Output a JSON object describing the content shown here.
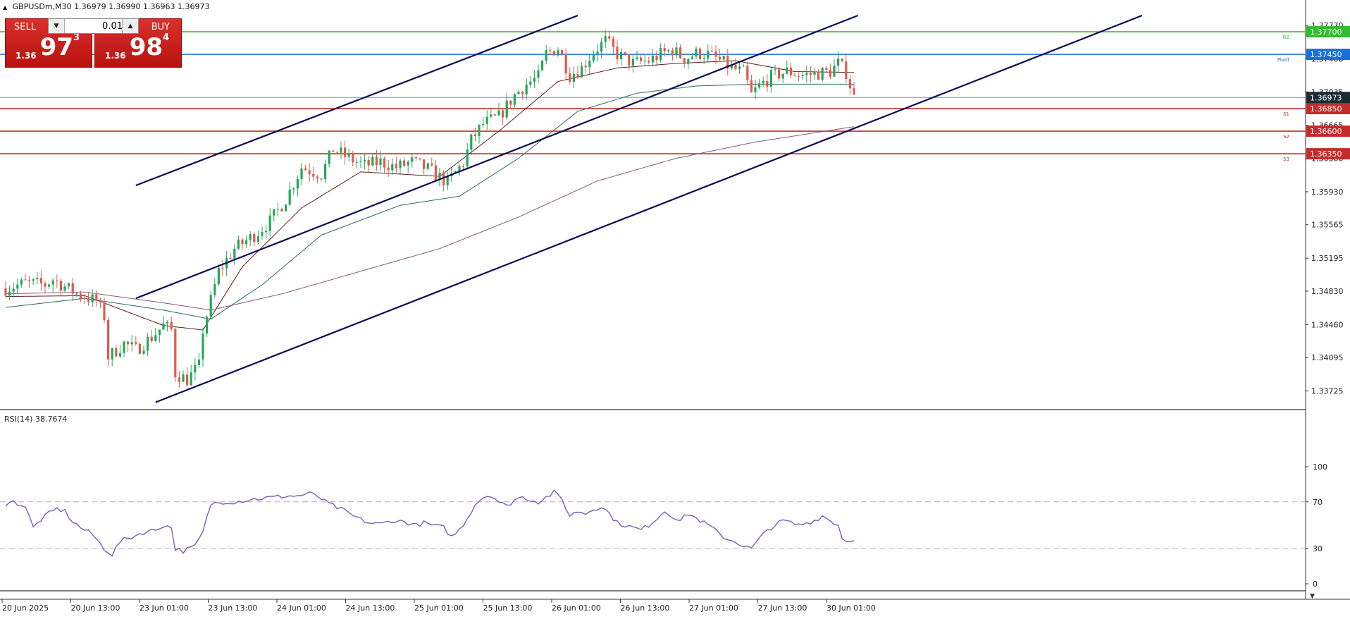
{
  "header": {
    "symbol": "GBPUSDm,M30",
    "ohlc": "1.36979 1.36990 1.36963 1.36973"
  },
  "trade_panel": {
    "sell_label": "SELL",
    "buy_label": "BUY",
    "lot_value": "0.01",
    "sell_price_main": "1.36",
    "sell_price_big": "97",
    "sell_price_sup": "3",
    "buy_price_main": "1.36",
    "buy_price_big": "98",
    "buy_price_sup": "4"
  },
  "colors": {
    "candle_up": "#26a65b",
    "candle_down": "#e05a4e",
    "channel": "#0b0b55",
    "level_r2": "#33bb33",
    "level_pivot": "#1a6fd6",
    "level_support": "#c62b2b",
    "current_price": "#1e2a33",
    "ma_fast": "#5a2020",
    "ma_mid": "#2f6a62",
    "ma_slow": "#8a5580",
    "rsi_line": "#7b5fb8"
  },
  "chart_data": {
    "type": "candlestick",
    "instrument": "GBPUSDm",
    "timeframe": "M30",
    "y_range": [
      1.3355,
      1.3788
    ],
    "price_ticks": [
      "1.37770",
      "1.37400",
      "1.37035",
      "1.36665",
      "1.36300",
      "1.35930",
      "1.35565",
      "1.35195",
      "1.34830",
      "1.34460",
      "1.34095",
      "1.33725"
    ],
    "x_ticks": [
      "20 Jun 2025",
      "20 Jun 13:00",
      "23 Jun 01:00",
      "23 Jun 13:00",
      "24 Jun 01:00",
      "24 Jun 13:00",
      "25 Jun 01:00",
      "25 Jun 13:00",
      "26 Jun 01:00",
      "26 Jun 13:00",
      "27 Jun 01:00",
      "27 Jun 13:00",
      "30 Jun 01:00"
    ],
    "current_price": "1.36973",
    "levels": [
      {
        "tag": "R2",
        "price": 1.377,
        "label": "1.37700",
        "kind": "r2"
      },
      {
        "tag": "Pivot",
        "price": 1.3745,
        "label": "1.37450",
        "kind": "pivot"
      },
      {
        "tag": "S1",
        "price": 1.3685,
        "label": "1.36850",
        "kind": "support"
      },
      {
        "tag": "S2",
        "price": 1.366,
        "label": "1.36600",
        "kind": "support"
      },
      {
        "tag": "S3",
        "price": 1.3635,
        "label": "1.36350",
        "kind": "support"
      }
    ],
    "price_anchors": [
      [
        0,
        1.3486
      ],
      [
        5,
        1.3492
      ],
      [
        10,
        1.349
      ],
      [
        12,
        1.3496
      ],
      [
        15,
        1.3488
      ],
      [
        18,
        1.348
      ],
      [
        23,
        1.3472
      ],
      [
        25,
        1.3455
      ],
      [
        26,
        1.341
      ],
      [
        30,
        1.3425
      ],
      [
        33,
        1.3418
      ],
      [
        37,
        1.3432
      ],
      [
        40,
        1.3445
      ],
      [
        42,
        1.344
      ],
      [
        43,
        1.3392
      ],
      [
        46,
        1.3385
      ],
      [
        49,
        1.34
      ],
      [
        50,
        1.344
      ],
      [
        54,
        1.3505
      ],
      [
        58,
        1.353
      ],
      [
        63,
        1.3545
      ],
      [
        67,
        1.356
      ],
      [
        71,
        1.3585
      ],
      [
        75,
        1.362
      ],
      [
        80,
        1.3612
      ],
      [
        83,
        1.364
      ],
      [
        87,
        1.363
      ],
      [
        91,
        1.3622
      ],
      [
        95,
        1.3626
      ],
      [
        99,
        1.362
      ],
      [
        103,
        1.3626
      ],
      [
        107,
        1.3618
      ],
      [
        112,
        1.3603
      ],
      [
        116,
        1.3625
      ],
      [
        118,
        1.365
      ],
      [
        121,
        1.3668
      ],
      [
        125,
        1.3676
      ],
      [
        129,
        1.37
      ],
      [
        132,
        1.3712
      ],
      [
        135,
        1.372
      ],
      [
        137,
        1.3746
      ],
      [
        140,
        1.3752
      ],
      [
        143,
        1.3722
      ],
      [
        146,
        1.373
      ],
      [
        149,
        1.3748
      ],
      [
        152,
        1.376
      ],
      [
        155,
        1.3745
      ],
      [
        159,
        1.3735
      ],
      [
        163,
        1.3738
      ],
      [
        166,
        1.3745
      ],
      [
        169,
        1.375
      ],
      [
        172,
        1.374
      ],
      [
        175,
        1.3746
      ],
      [
        178,
        1.3745
      ],
      [
        181,
        1.3738
      ],
      [
        184,
        1.373
      ],
      [
        187,
        1.3725
      ],
      [
        189,
        1.37
      ],
      [
        191,
        1.371
      ],
      [
        194,
        1.372
      ],
      [
        198,
        1.3726
      ],
      [
        202,
        1.3722
      ],
      [
        206,
        1.3724
      ],
      [
        209,
        1.3726
      ],
      [
        211,
        1.3735
      ],
      [
        213,
        1.3725
      ],
      [
        215,
        1.3697
      ]
    ],
    "moving_averages": [
      {
        "id": "ma-fast",
        "color_key": "ma_fast",
        "points": [
          [
            0,
            1.3477
          ],
          [
            20,
            1.3478
          ],
          [
            40,
            1.3445
          ],
          [
            50,
            1.344
          ],
          [
            60,
            1.351
          ],
          [
            75,
            1.3575
          ],
          [
            90,
            1.3615
          ],
          [
            110,
            1.361
          ],
          [
            125,
            1.366
          ],
          [
            140,
            1.3715
          ],
          [
            155,
            1.373
          ],
          [
            170,
            1.3735
          ],
          [
            185,
            1.3738
          ],
          [
            200,
            1.3726
          ],
          [
            215,
            1.3725
          ]
        ]
      },
      {
        "id": "ma-mid",
        "color_key": "ma_mid",
        "points": [
          [
            0,
            1.3465
          ],
          [
            20,
            1.3475
          ],
          [
            40,
            1.3462
          ],
          [
            52,
            1.3452
          ],
          [
            65,
            1.349
          ],
          [
            80,
            1.3545
          ],
          [
            100,
            1.3578
          ],
          [
            115,
            1.3588
          ],
          [
            130,
            1.363
          ],
          [
            145,
            1.3682
          ],
          [
            160,
            1.3702
          ],
          [
            175,
            1.371
          ],
          [
            190,
            1.3712
          ],
          [
            215,
            1.3712
          ]
        ]
      },
      {
        "id": "ma-slow",
        "color_key": "ma_slow",
        "points": [
          [
            0,
            1.348
          ],
          [
            20,
            1.3482
          ],
          [
            40,
            1.347
          ],
          [
            52,
            1.3462
          ],
          [
            70,
            1.348
          ],
          [
            90,
            1.3505
          ],
          [
            110,
            1.353
          ],
          [
            130,
            1.3565
          ],
          [
            150,
            1.3605
          ],
          [
            170,
            1.363
          ],
          [
            190,
            1.3648
          ],
          [
            215,
            1.3665
          ]
        ]
      }
    ],
    "channels": [
      {
        "id": "channel-upper-line",
        "from": [
          33,
          1.36
        ],
        "to": [
          145,
          1.3788
        ]
      },
      {
        "id": "channel-middle-line",
        "from": [
          33,
          1.3475
        ],
        "to": [
          216,
          1.3788
        ]
      },
      {
        "id": "channel-lower-line",
        "from": [
          38,
          1.336
        ],
        "to": [
          288,
          1.3788
        ]
      }
    ],
    "rsi": {
      "label": "RSI(14) 38.7674",
      "levels": [
        70,
        30
      ],
      "y_ticks": [
        "100",
        "70",
        "30",
        "0"
      ],
      "anchors": [
        [
          0,
          68
        ],
        [
          2,
          70
        ],
        [
          5,
          66
        ],
        [
          7,
          48
        ],
        [
          9,
          55
        ],
        [
          11,
          60
        ],
        [
          13,
          64
        ],
        [
          15,
          62
        ],
        [
          17,
          53
        ],
        [
          19,
          48
        ],
        [
          22,
          42
        ],
        [
          25,
          30
        ],
        [
          27,
          25
        ],
        [
          29,
          36
        ],
        [
          32,
          40
        ],
        [
          35,
          44
        ],
        [
          38,
          46
        ],
        [
          40,
          50
        ],
        [
          42,
          48
        ],
        [
          43,
          30
        ],
        [
          45,
          28
        ],
        [
          48,
          32
        ],
        [
          50,
          44
        ],
        [
          52,
          68
        ],
        [
          55,
          70
        ],
        [
          58,
          70
        ],
        [
          62,
          72
        ],
        [
          65,
          73
        ],
        [
          68,
          74
        ],
        [
          71,
          75
        ],
        [
          74,
          75
        ],
        [
          77,
          77
        ],
        [
          79,
          75
        ],
        [
          81,
          70
        ],
        [
          84,
          65
        ],
        [
          86,
          62
        ],
        [
          88,
          58
        ],
        [
          90,
          55
        ],
        [
          92,
          52
        ],
        [
          95,
          51
        ],
        [
          98,
          54
        ],
        [
          101,
          53
        ],
        [
          104,
          50
        ],
        [
          106,
          52
        ],
        [
          108,
          50
        ],
        [
          111,
          48
        ],
        [
          113,
          40
        ],
        [
          115,
          46
        ],
        [
          117,
          56
        ],
        [
          119,
          68
        ],
        [
          121,
          74
        ],
        [
          123,
          76
        ],
        [
          125,
          70
        ],
        [
          127,
          66
        ],
        [
          129,
          72
        ],
        [
          131,
          74
        ],
        [
          133,
          72
        ],
        [
          135,
          70
        ],
        [
          137,
          74
        ],
        [
          139,
          78
        ],
        [
          141,
          72
        ],
        [
          143,
          58
        ],
        [
          145,
          62
        ],
        [
          147,
          60
        ],
        [
          149,
          64
        ],
        [
          151,
          66
        ],
        [
          153,
          60
        ],
        [
          155,
          52
        ],
        [
          157,
          50
        ],
        [
          159,
          48
        ],
        [
          161,
          46
        ],
        [
          163,
          50
        ],
        [
          165,
          56
        ],
        [
          167,
          62
        ],
        [
          169,
          58
        ],
        [
          171,
          54
        ],
        [
          173,
          60
        ],
        [
          175,
          56
        ],
        [
          177,
          52
        ],
        [
          179,
          48
        ],
        [
          181,
          42
        ],
        [
          183,
          38
        ],
        [
          185,
          36
        ],
        [
          187,
          32
        ],
        [
          189,
          30
        ],
        [
          191,
          38
        ],
        [
          193,
          46
        ],
        [
          195,
          50
        ],
        [
          197,
          54
        ],
        [
          199,
          52
        ],
        [
          201,
          50
        ],
        [
          203,
          52
        ],
        [
          205,
          54
        ],
        [
          207,
          58
        ],
        [
          209,
          54
        ],
        [
          211,
          50
        ],
        [
          212,
          40
        ],
        [
          213,
          36
        ],
        [
          215,
          38.8
        ]
      ]
    }
  }
}
